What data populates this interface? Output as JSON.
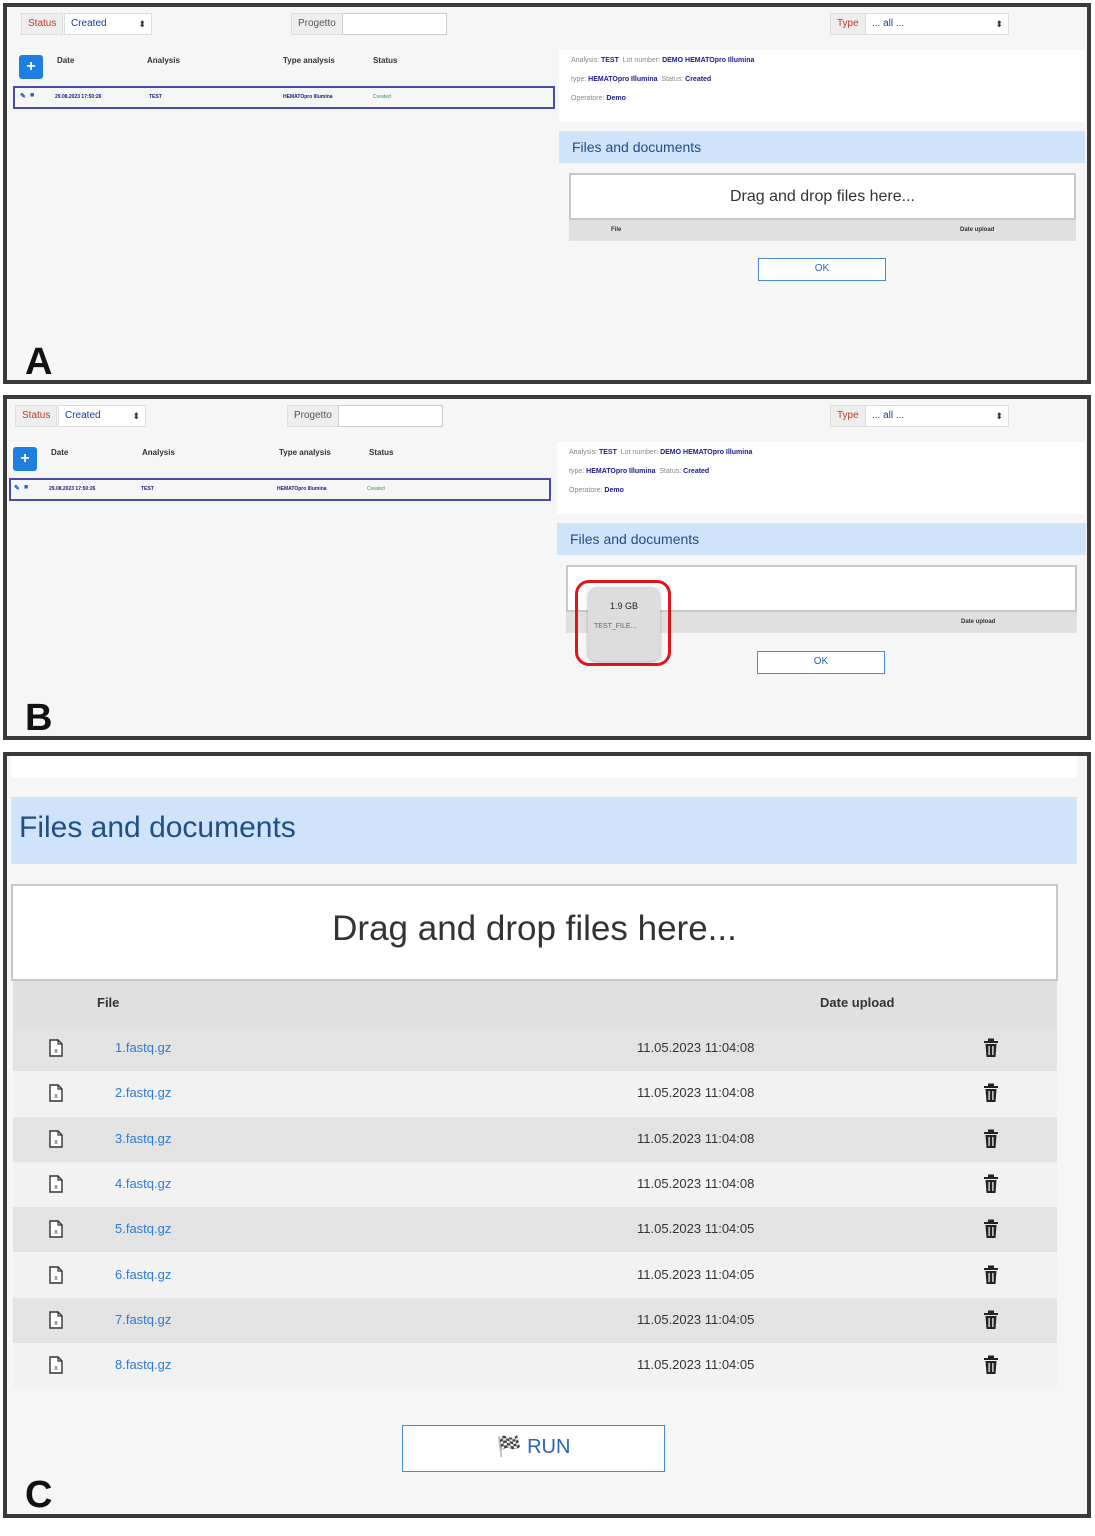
{
  "filters": {
    "status_label": "Status",
    "status_value": "Created",
    "progetto_label": "Progetto",
    "type_label": "Type",
    "type_value": "... all ..."
  },
  "table": {
    "add_label": "+",
    "columns": [
      "Date",
      "Analysis",
      "Type analysis",
      "Status"
    ],
    "row": {
      "date": "29.08.2023 17:50:26",
      "analysis": "TEST",
      "type": "HEMATOpro Illumina",
      "status": "Created"
    }
  },
  "info": {
    "analysis_label": "Analysis:",
    "analysis_value": "TEST",
    "lot_label": "Lot number:",
    "lot_value": "DEMO HEMATOpro Illumina",
    "type_label": "type:",
    "type_value": "HEMATOpro Illumina",
    "status_label": "Status:",
    "status_value": "Created",
    "operator_label": "Operatore:",
    "operator_value": "Demo"
  },
  "files_section": {
    "title": "Files and documents",
    "dropzone": "Drag and drop files here...",
    "col_file": "File",
    "col_date": "Date upload",
    "ok_label": "OK",
    "run_label": "RUN"
  },
  "drag_preview": {
    "size": "1.9 GB",
    "name": "TEST_FILE..."
  },
  "panel_labels": [
    "A",
    "B",
    "C"
  ],
  "files": [
    {
      "name": "1.fastq.gz",
      "date": "11.05.2023 11:04:08"
    },
    {
      "name": "2.fastq.gz",
      "date": "11.05.2023 11:04:08"
    },
    {
      "name": "3.fastq.gz",
      "date": "11.05.2023 11:04:08"
    },
    {
      "name": "4.fastq.gz",
      "date": "11.05.2023 11:04:08"
    },
    {
      "name": "5.fastq.gz",
      "date": "11.05.2023 11:04:05"
    },
    {
      "name": "6.fastq.gz",
      "date": "11.05.2023 11:04:05"
    },
    {
      "name": "7.fastq.gz",
      "date": "11.05.2023 11:04:05"
    },
    {
      "name": "8.fastq.gz",
      "date": "11.05.2023 11:04:05"
    }
  ],
  "colors": {
    "accent": "#1e7fe0",
    "header_bg": "#cfe3fb",
    "highlight": "#e0141e",
    "status_green": "#2a9c3a"
  }
}
